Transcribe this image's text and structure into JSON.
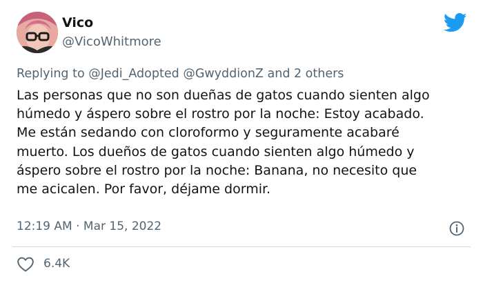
{
  "author": {
    "display_name": "Vico",
    "handle": "@VicoWhitmore",
    "avatar_icon": "user-avatar"
  },
  "brand": {
    "logo_icon": "twitter-bird-icon",
    "color": "#1d9bf0"
  },
  "reply": {
    "prefix": "Replying to",
    "mention_1": "@Jedi_Adopted",
    "mention_2": "@GwyddionZ",
    "suffix": "and 2 others"
  },
  "tweet": {
    "lines": [
      "Las personas que no son dueñas de gatos cuando sienten algo",
      "húmedo y áspero sobre el rostro por la noche: Estoy acabado.",
      "Me están sedando con cloroformo y seguramente acabaré",
      "muerto. Los dueños de gatos cuando sienten algo húmedo y",
      "áspero sobre el rostro por la noche: Banana, no necesito que",
      "me acicalen. Por favor, déjame dormir."
    ]
  },
  "meta": {
    "time": "12:19 AM",
    "separator": "·",
    "date": "Mar 15, 2022",
    "info_icon": "info-icon"
  },
  "engagement": {
    "like_icon": "heart-icon",
    "like_count": "6.4K"
  },
  "colors": {
    "text_primary": "#0f1419",
    "text_secondary": "#536471",
    "divider": "#cfd9de"
  }
}
